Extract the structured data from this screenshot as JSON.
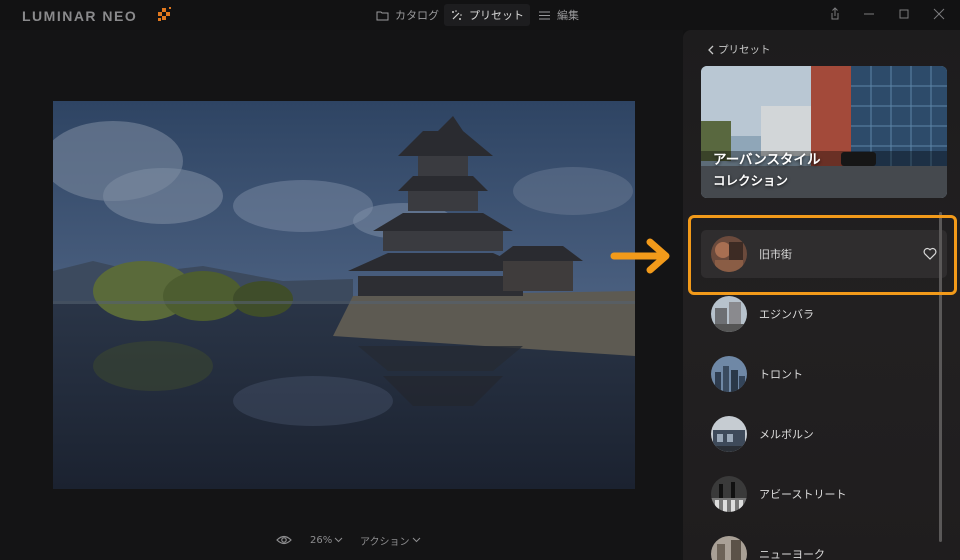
{
  "app": {
    "logo_text": "LUMINAR NEO"
  },
  "nav": {
    "catalog": "カタログ",
    "presets": "プリセット",
    "edit": "編集"
  },
  "bottom_tools": {
    "zoom": "26%",
    "actions": "アクション"
  },
  "panel": {
    "back_label": "プリセット",
    "collection": {
      "title": "アーバンスタイル",
      "subtitle": "コレクション"
    },
    "presets": [
      {
        "label": "旧市街",
        "selected": true,
        "favorite_icon": "heart-icon"
      },
      {
        "label": "エジンバラ"
      },
      {
        "label": "トロント"
      },
      {
        "label": "メルボルン"
      },
      {
        "label": "アビーストリート"
      },
      {
        "label": "ニューヨーク"
      }
    ]
  },
  "colors": {
    "accent_orange": "#f29a1a",
    "background": "#121213",
    "panel": "#1f1d1e"
  }
}
